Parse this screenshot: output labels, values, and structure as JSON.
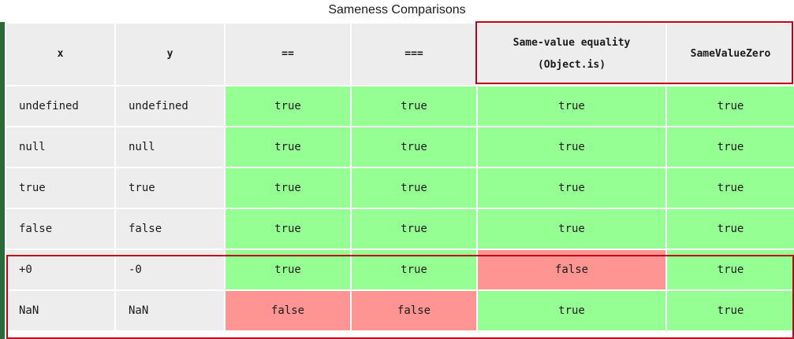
{
  "caption": "Sameness Comparisons",
  "headers": {
    "x": "x",
    "y": "y",
    "loose": "==",
    "strict": "===",
    "same_value_line1": "Same-value equality",
    "same_value_line2": "(Object.is)",
    "same_value_zero": "SameValueZero"
  },
  "rows": [
    {
      "x": "undefined",
      "y": "undefined",
      "loose": "true",
      "strict": "true",
      "same_value": "true",
      "same_value_zero": "true"
    },
    {
      "x": "null",
      "y": "null",
      "loose": "true",
      "strict": "true",
      "same_value": "true",
      "same_value_zero": "true"
    },
    {
      "x": "true",
      "y": "true",
      "loose": "true",
      "strict": "true",
      "same_value": "true",
      "same_value_zero": "true"
    },
    {
      "x": "false",
      "y": "false",
      "loose": "true",
      "strict": "true",
      "same_value": "true",
      "same_value_zero": "true"
    },
    {
      "x": "+0",
      "y": "-0",
      "loose": "true",
      "strict": "true",
      "same_value": "false",
      "same_value_zero": "true"
    },
    {
      "x": "NaN",
      "y": "NaN",
      "loose": "false",
      "strict": "false",
      "same_value": "true",
      "same_value_zero": "true"
    }
  ],
  "colors": {
    "true_cell": "#96ff93",
    "false_cell": "#ff9592",
    "label_cell": "#ededed",
    "highlight_border": "#c00018",
    "left_bar": "#2a6b3a"
  }
}
